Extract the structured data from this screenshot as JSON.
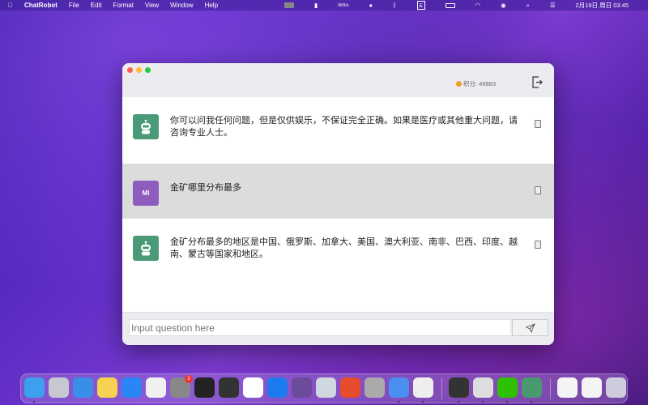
{
  "menubar": {
    "app": "ChatRobot",
    "items": [
      "File",
      "Edit",
      "Format",
      "View",
      "Window",
      "Help"
    ],
    "datetime": "2月19日 周日 03:45",
    "ime": "五",
    "net_speed": "0KB/s"
  },
  "window": {
    "score_label": "积分: 49883",
    "input_placeholder": "Input question here",
    "messages": [
      {
        "role": "bot",
        "text": "你可以问我任何问题，但是仅供娱乐，不保证完全正确。如果是医疗或其他重大问题，请咨询专业人士。"
      },
      {
        "role": "user",
        "avatar_text": "MI",
        "text": "金矿哪里分布最多"
      },
      {
        "role": "bot",
        "text": "金矿分布最多的地区是中国、俄罗斯、加拿大、美国、澳大利亚、南非、巴西、印度、越南、蒙古等国家和地区。"
      }
    ]
  },
  "dock": {
    "apps": [
      {
        "name": "finder",
        "color": "#3d9ff0",
        "running": true
      },
      {
        "name": "launchpad",
        "color": "#c8c8d0"
      },
      {
        "name": "safari",
        "color": "#3a8ee8"
      },
      {
        "name": "notes",
        "color": "#f5d251"
      },
      {
        "name": "app-store",
        "color": "#2a86f5"
      },
      {
        "name": "textedit",
        "color": "#f0f0f0"
      },
      {
        "name": "system-settings",
        "color": "#888",
        "badge": "2"
      },
      {
        "name": "terminal",
        "color": "#222"
      },
      {
        "name": "console",
        "color": "#333"
      },
      {
        "name": "baidu-netdisk",
        "color": "#fff"
      },
      {
        "name": "lark",
        "color": "#1d7bf0"
      },
      {
        "name": "blender",
        "color": "#6b4b9a"
      },
      {
        "name": "preview",
        "color": "#cfd8e0"
      },
      {
        "name": "wps",
        "color": "#e84c2e"
      },
      {
        "name": "database",
        "color": "#aaa"
      },
      {
        "name": "xcode",
        "color": "#4a8ef0",
        "running": true
      },
      {
        "name": "chrome",
        "color": "#eee",
        "running": true
      },
      {
        "name": "keychain",
        "color": "#333",
        "running": true
      },
      {
        "name": "wechat-devtools",
        "color": "#ddd",
        "running": true
      },
      {
        "name": "wechat",
        "color": "#2dc100",
        "running": true
      },
      {
        "name": "chatrobot",
        "color": "#4a9a70",
        "running": true
      },
      {
        "name": "recent-window-1",
        "color": "#f4f4f4"
      },
      {
        "name": "recent-window-2",
        "color": "#f4f4f4"
      },
      {
        "name": "trash",
        "color": "#ccd"
      }
    ]
  },
  "colors": {
    "bot_avatar": "#4a9a78",
    "user_avatar": "#8e5cbf",
    "user_row": "#dcdcdc"
  }
}
